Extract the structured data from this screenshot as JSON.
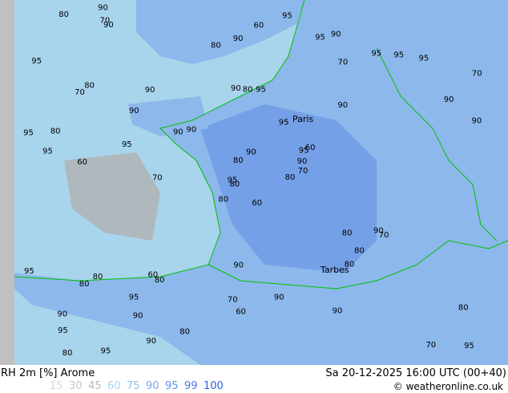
{
  "header": {
    "title": "RH 2m [%] Arome",
    "datetime": "Sa 20-12-2025 16:00 UTC (00+40)",
    "copyright": "© weatheronline.co.uk"
  },
  "legend": [
    {
      "value": "15",
      "color": "#d8d8d8"
    },
    {
      "value": "30",
      "color": "#c8c8c8"
    },
    {
      "value": "45",
      "color": "#b8b8b8"
    },
    {
      "value": "60",
      "color": "#a8d4ec"
    },
    {
      "value": "75",
      "color": "#8cc0e8"
    },
    {
      "value": "90",
      "color": "#78a8e8"
    },
    {
      "value": "95",
      "color": "#6090e8"
    },
    {
      "value": "99",
      "color": "#4878e0"
    },
    {
      "value": "100",
      "color": "#3060d8"
    }
  ],
  "map": {
    "cities": [
      "Paris",
      "Tarbes"
    ],
    "labels": [
      "60",
      "70",
      "80",
      "90",
      "95",
      "80",
      "90",
      "95",
      "70",
      "80",
      "90",
      "95",
      "60",
      "70",
      "80",
      "90",
      "95",
      "90",
      "95",
      "80",
      "90",
      "95",
      "90",
      "80"
    ],
    "colors": {
      "offmap": "#c0c0c0",
      "sea": "#a8d4ec",
      "land": "#8cb8ec",
      "humid": "#6a96e6",
      "border": "#00c000",
      "terrain": "#8a8a8a"
    }
  }
}
